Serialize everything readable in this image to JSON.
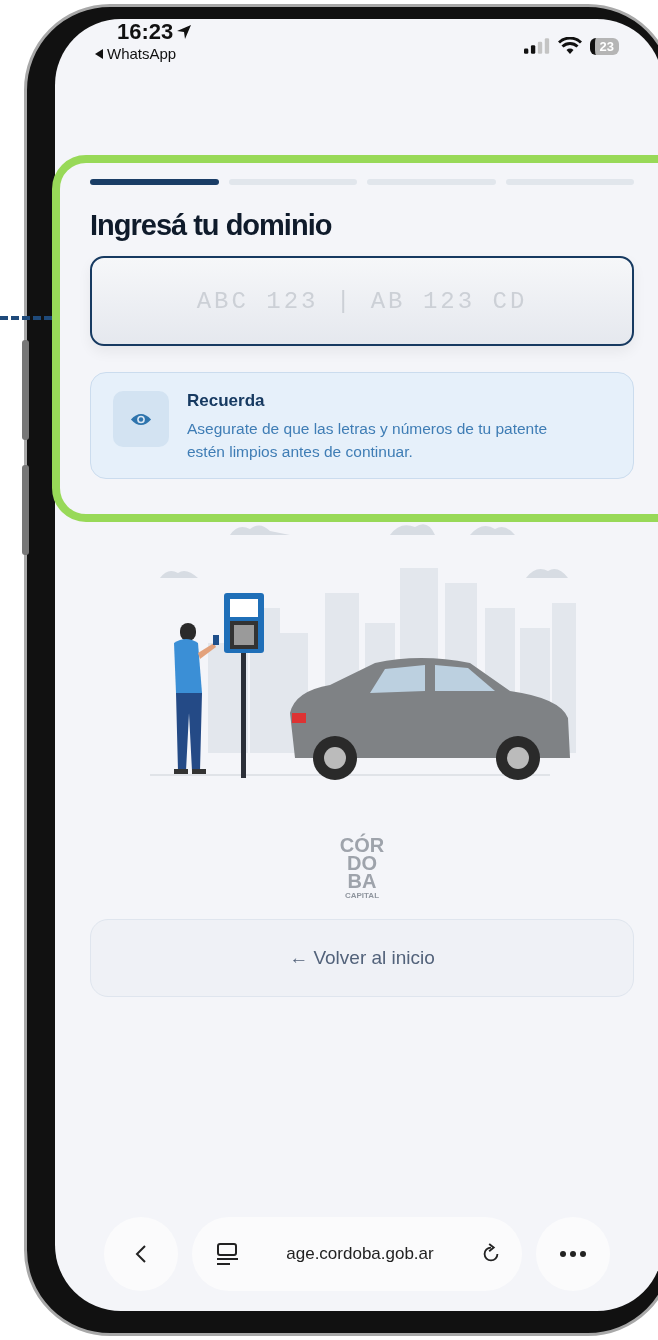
{
  "status_bar": {
    "time": "16:23",
    "back_app": "WhatsApp",
    "battery": "23"
  },
  "progress_steps": [
    {
      "selected": true
    },
    {
      "selected": false
    },
    {
      "selected": false
    },
    {
      "selected": false
    }
  ],
  "title": "Ingresá tu dominio",
  "plate_field": {
    "placeholder": "ABC 123 | AB 123 CD"
  },
  "notice": {
    "title": "Recuerda",
    "text": "Asegurate de que las letras y números de tu patente estén limpios antes de continuar."
  },
  "logo": {
    "lines": [
      "CÓR",
      "DO",
      "BA"
    ],
    "caption": "CAPITAL"
  },
  "back_button": {
    "label": "← Volver al inicio"
  },
  "browser_bar": {
    "url": "age.cordoba.gob.ar"
  }
}
